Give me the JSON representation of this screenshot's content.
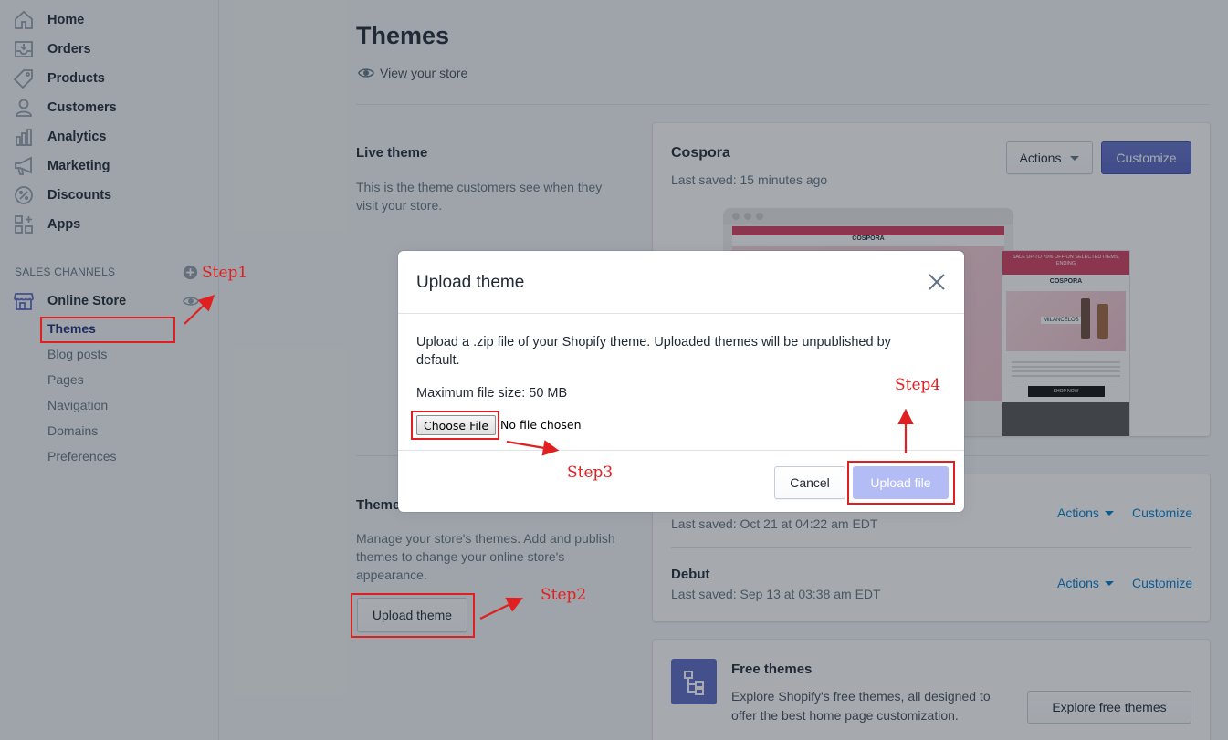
{
  "sidebar": {
    "nav": [
      {
        "label": "Home",
        "icon": "home-icon"
      },
      {
        "label": "Orders",
        "icon": "orders-icon"
      },
      {
        "label": "Products",
        "icon": "tag-icon"
      },
      {
        "label": "Customers",
        "icon": "person-icon"
      },
      {
        "label": "Analytics",
        "icon": "chart-icon"
      },
      {
        "label": "Marketing",
        "icon": "megaphone-icon"
      },
      {
        "label": "Discounts",
        "icon": "discount-icon"
      },
      {
        "label": "Apps",
        "icon": "apps-icon"
      }
    ],
    "sales_channels_label": "SALES CHANNELS",
    "online_store_label": "Online Store",
    "sub_items": [
      "Themes",
      "Blog posts",
      "Pages",
      "Navigation",
      "Domains",
      "Preferences"
    ]
  },
  "main": {
    "title": "Themes",
    "view_store": "View your store",
    "live_theme": {
      "heading": "Live theme",
      "description": "This is the theme customers see when they visit your store.",
      "name": "Cospora",
      "saved": "Last saved: 15 minutes ago",
      "actions_label": "Actions",
      "customize_label": "Customize",
      "preview_banner": "SALE UP TO 70% OFF ON SELECTED ITEMS, ENDING",
      "preview_logo": "COSPORA",
      "preview_product": "MILANCELOS",
      "preview_shop_now": "SHOP NOW"
    },
    "theme_library": {
      "heading": "Theme library",
      "description": "Manage your store's themes. Add and publish themes to change your online store's appearance.",
      "upload_label": "Upload theme",
      "items": [
        {
          "saved": "Last saved: Oct 21 at 04:22 am EDT",
          "actions": "Actions",
          "customize": "Customize"
        },
        {
          "name": "Debut",
          "saved": "Last saved: Sep 13 at 03:38 am EDT",
          "actions": "Actions",
          "customize": "Customize"
        }
      ]
    },
    "free_themes": {
      "title": "Free themes",
      "description": "Explore Shopify's free themes, all designed to offer the best home page customization.",
      "button": "Explore free themes"
    }
  },
  "modal": {
    "title": "Upload theme",
    "description": "Upload a .zip file of your Shopify theme. Uploaded themes will be unpublished by default.",
    "max_size": "Maximum file size: 50 MB",
    "choose_file": "Choose File",
    "file_status": "No file chosen",
    "cancel": "Cancel",
    "upload": "Upload file"
  },
  "annotations": {
    "step1": "Step1",
    "step2": "Step2",
    "step3": "Step3",
    "step4": "Step4",
    "color": "#e02020"
  },
  "colors": {
    "primary": "#5c6ac4",
    "primary_disabled": "#b3bcf5",
    "link": "#007ace",
    "active_nav": "#202e78"
  }
}
